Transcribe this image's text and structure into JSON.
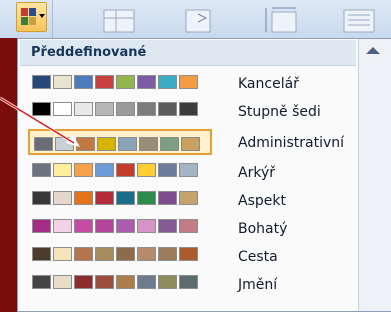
{
  "menu": {
    "header": "Předdefinované",
    "themes": [
      {
        "label": "Kancelář",
        "colors": [
          "#284878",
          "#eae3cf",
          "#4c7cbc",
          "#c84040",
          "#94b44c",
          "#7c5ca4",
          "#3cacc4",
          "#f49c44"
        ]
      },
      {
        "label": "Stupně šedi",
        "colors": [
          "#000000",
          "#ffffff",
          "#e8e8e8",
          "#b6b6b6",
          "#9a9a9a",
          "#7c7c7c",
          "#5c5c5c",
          "#3c3c3c"
        ]
      },
      {
        "label": "Administrativní",
        "colors": [
          "#686e78",
          "#c8d0d6",
          "#c27843",
          "#d8b400",
          "#88a4b6",
          "#9a8c76",
          "#7e9e84",
          "#c8a060"
        ]
      },
      {
        "label": "Arkýř",
        "colors": [
          "#6c7482",
          "#ffef9c",
          "#f4a14a",
          "#6c9ad6",
          "#c43c2c",
          "#ffcc33",
          "#6c7c9a",
          "#a4b4c4"
        ]
      },
      {
        "label": "Aspekt",
        "colors": [
          "#383838",
          "#e4d8cc",
          "#e4741c",
          "#b42c3c",
          "#1c6c8c",
          "#2c8c4c",
          "#7c4c8c",
          "#c4a46c"
        ]
      },
      {
        "label": "Bohatý",
        "colors": [
          "#a42c84",
          "#f4d2e8",
          "#c44ca4",
          "#b4449c",
          "#ac5cac",
          "#d494c4",
          "#845c94",
          "#c47c84"
        ]
      },
      {
        "label": "Cesta",
        "colors": [
          "#4c3c2c",
          "#f4e4bc",
          "#b4744c",
          "#a48c5c",
          "#8c6c4c",
          "#b48c6c",
          "#9c7c5c",
          "#ac5c2c"
        ]
      },
      {
        "label": "Jmění",
        "colors": [
          "#444444",
          "#e8ddc8",
          "#8c2c2c",
          "#9c4c3c",
          "#ac7c4c",
          "#6c7c8c",
          "#8c8c5c",
          "#5c6c6c"
        ]
      }
    ],
    "selected_index": 2
  },
  "theme_button": {
    "mini_colors": [
      "#c43c2c",
      "#2c4c8c",
      "#3c7c3c",
      "#c8a040"
    ]
  },
  "colors": {
    "background": "#7b0c0c",
    "selection_border": "#e39f36",
    "selection_fill": "#fff1cc"
  }
}
